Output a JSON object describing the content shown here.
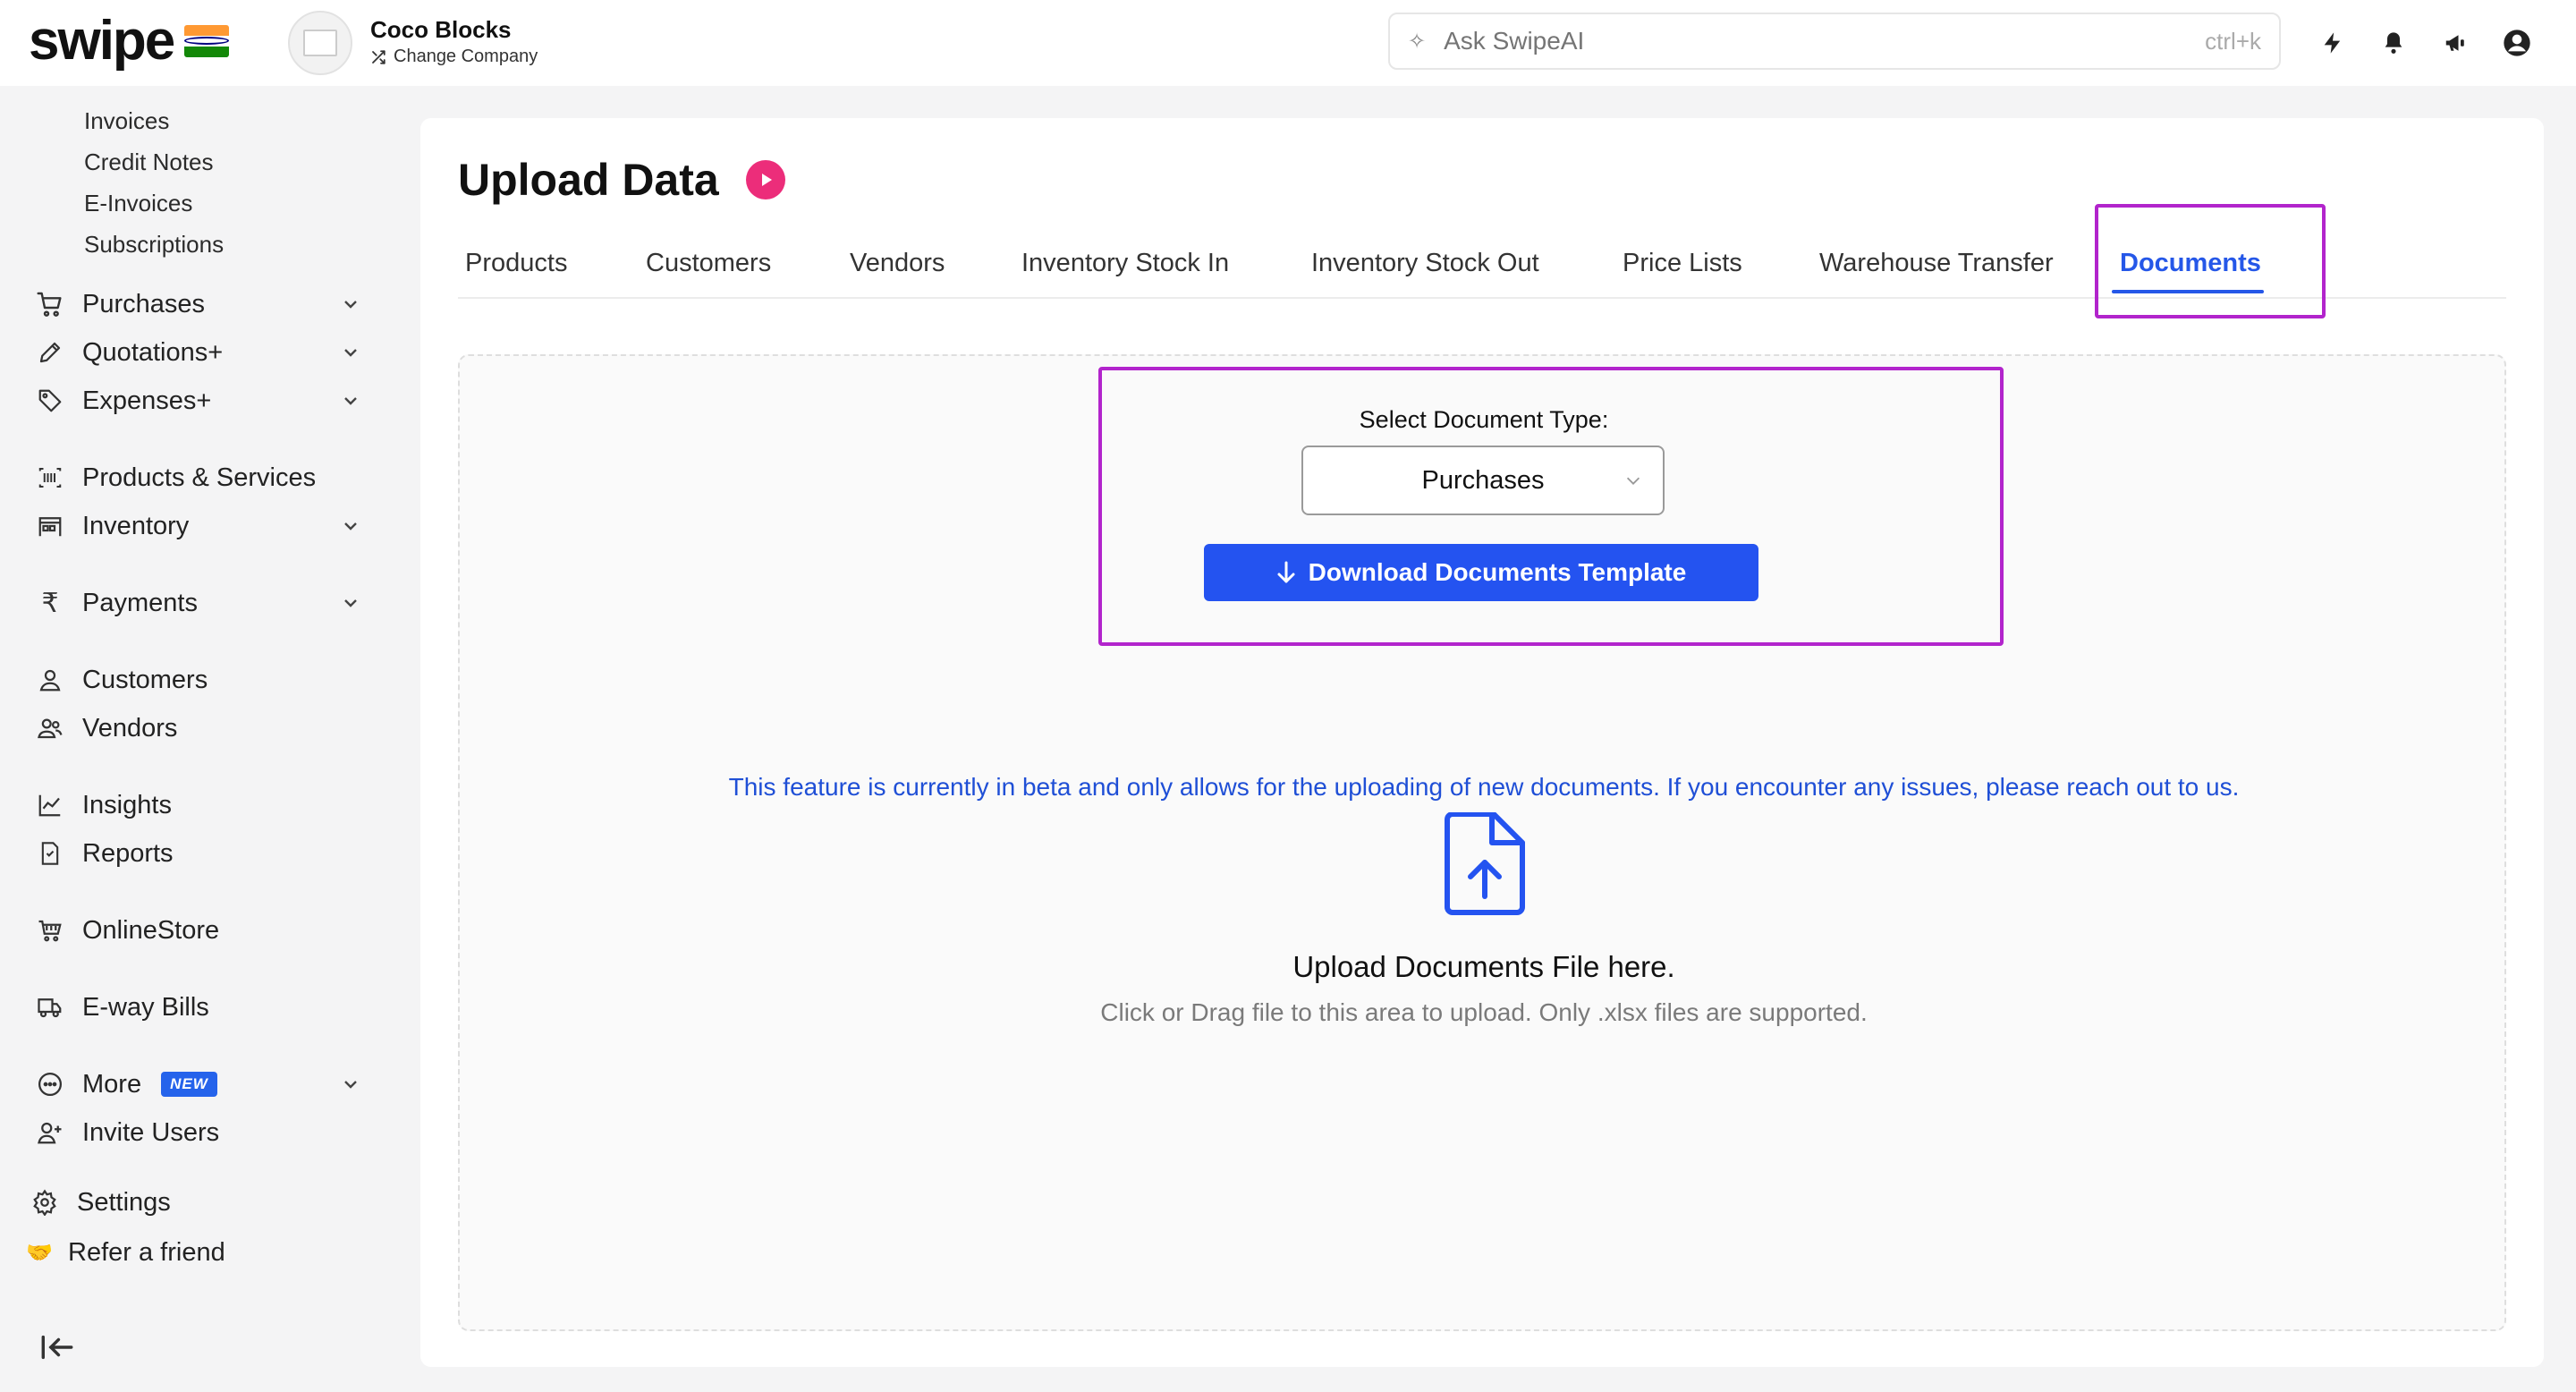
{
  "header": {
    "logo": "swipe",
    "company_name": "Coco Blocks",
    "change_company": "Change Company",
    "search_placeholder": "Ask SwipeAI",
    "search_shortcut": "ctrl+k"
  },
  "sidebar": {
    "sub_items": [
      "Invoices",
      "Credit Notes",
      "E-Invoices",
      "Subscriptions"
    ],
    "items": [
      {
        "label": "Purchases",
        "icon": "cart-icon",
        "expandable": true
      },
      {
        "label": "Quotations+",
        "icon": "pen-icon",
        "expandable": true
      },
      {
        "label": "Expenses+",
        "icon": "tag-icon",
        "expandable": true
      },
      {
        "label": "Products & Services",
        "icon": "barcode-icon",
        "expandable": false
      },
      {
        "label": "Inventory",
        "icon": "warehouse-icon",
        "expandable": true
      },
      {
        "label": "Payments",
        "icon": "rupee-icon",
        "expandable": true
      },
      {
        "label": "Customers",
        "icon": "user-icon",
        "expandable": false
      },
      {
        "label": "Vendors",
        "icon": "users-icon",
        "expandable": false
      },
      {
        "label": "Insights",
        "icon": "chart-icon",
        "expandable": false
      },
      {
        "label": "Reports",
        "icon": "report-icon",
        "expandable": false
      },
      {
        "label": "OnlineStore",
        "icon": "store-icon",
        "expandable": false
      },
      {
        "label": "E-way Bills",
        "icon": "truck-icon",
        "expandable": false
      },
      {
        "label": "More",
        "icon": "more-icon",
        "expandable": true,
        "badge": "NEW"
      },
      {
        "label": "Invite Users",
        "icon": "user-plus-icon",
        "expandable": false
      }
    ],
    "settings": "Settings",
    "refer": "Refer a friend",
    "refer_emoji": "🤝"
  },
  "main": {
    "title": "Upload Data",
    "tabs": [
      {
        "label": "Products"
      },
      {
        "label": "Customers"
      },
      {
        "label": "Vendors"
      },
      {
        "label": "Inventory Stock In"
      },
      {
        "label": "Inventory Stock Out"
      },
      {
        "label": "Price Lists"
      },
      {
        "label": "Warehouse Transfer"
      },
      {
        "label": "Documents",
        "active": true
      }
    ],
    "select_label": "Select Document Type:",
    "selected_type": "Purchases",
    "download_button": "Download Documents Template",
    "beta_note": "This feature is currently in beta and only allows for the uploading of new documents. If you encounter any issues, please reach out to us.",
    "upload_title": "Upload Documents File here.",
    "upload_subtitle": "Click or Drag file to this area to upload. Only .xlsx files are supported."
  },
  "colors": {
    "accent": "#2453f0",
    "highlight": "#b224cc",
    "beta_text": "#1f4fd6",
    "play": "#ec2d7a"
  }
}
